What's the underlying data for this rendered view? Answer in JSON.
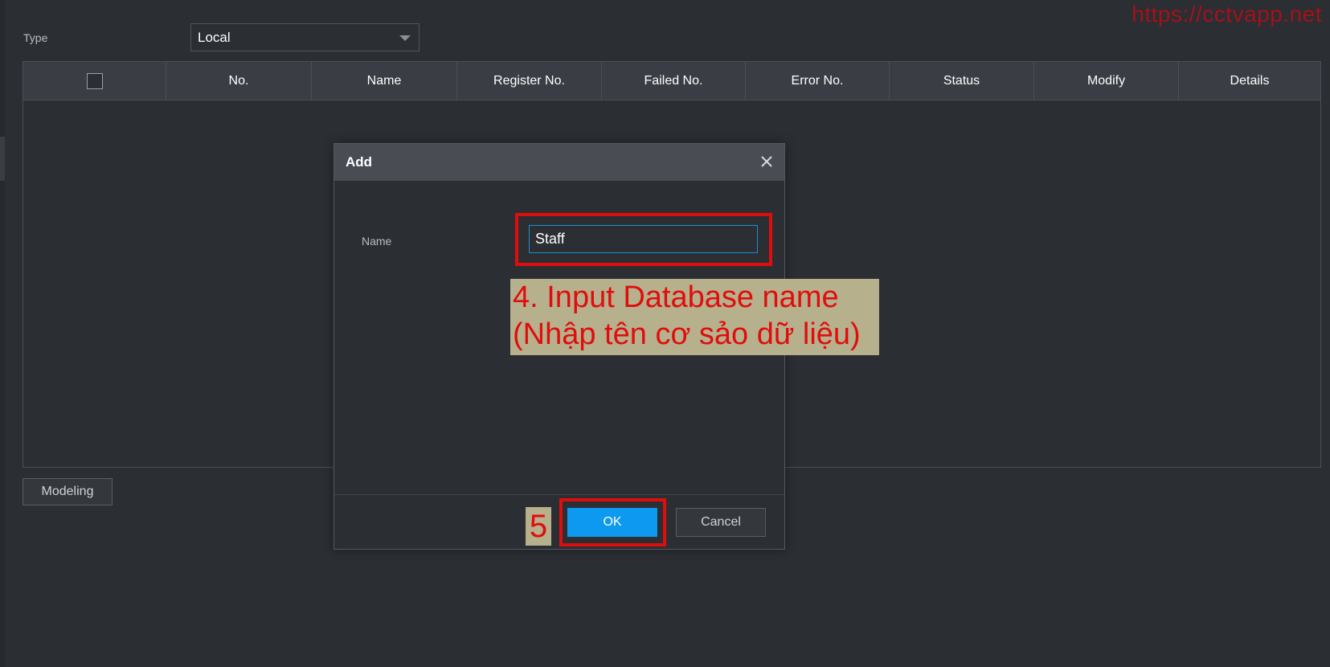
{
  "watermark": {
    "url": "https://cctvapp.net"
  },
  "type_filter": {
    "label": "Type",
    "selected": "Local"
  },
  "table": {
    "columns": [
      "No.",
      "Name",
      "Register No.",
      "Failed No.",
      "Error No.",
      "Status",
      "Modify",
      "Details"
    ],
    "rows": []
  },
  "modeling_button": {
    "label": "Modeling"
  },
  "dialog": {
    "title": "Add",
    "name_label": "Name",
    "name_value": "Staff",
    "ok_label": "OK",
    "cancel_label": "Cancel"
  },
  "annotations": {
    "step4_line1": "4. Input Database name",
    "step4_line2": "(Nhập tên cơ sảo dữ liệu)",
    "step5": "5",
    "highlight_color": "#e00d0d"
  },
  "colors": {
    "background": "#2b2e33",
    "header": "#3a3d43",
    "dialog_header": "#494c52",
    "primary_button": "#0d99ef",
    "input_focus_border": "#1b8fd6",
    "callout_bg": "#b7b08c",
    "annotation_text": "#e00d0d"
  }
}
